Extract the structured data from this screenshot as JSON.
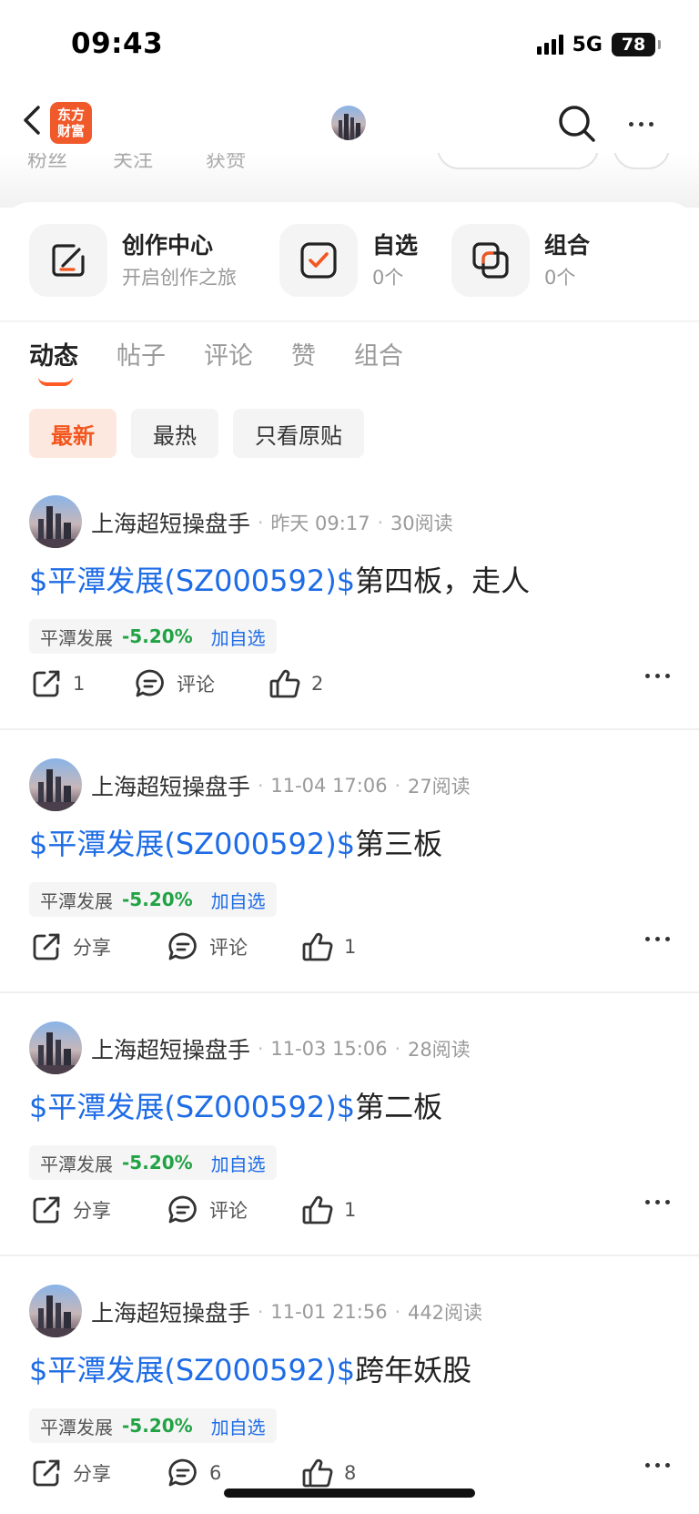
{
  "status_bar": {
    "time": "09:43",
    "network": "5G",
    "battery": "78"
  },
  "header": {
    "app_logo_line1": "东方",
    "app_logo_line2": "财富"
  },
  "faded_row": {
    "labels": [
      "粉丝",
      "关注",
      "获赞"
    ]
  },
  "quick_actions": [
    {
      "title": "创作中心",
      "subtitle": "开启创作之旅",
      "icon": "edit-icon"
    },
    {
      "title": "自选",
      "subtitle": "0个",
      "icon": "checkbox-icon"
    },
    {
      "title": "组合",
      "subtitle": "0个",
      "icon": "portfolio-icon"
    }
  ],
  "tabs": [
    {
      "label": "动态",
      "active": true
    },
    {
      "label": "帖子",
      "active": false
    },
    {
      "label": "评论",
      "active": false
    },
    {
      "label": "赞",
      "active": false
    },
    {
      "label": "组合",
      "active": false
    }
  ],
  "filters": [
    {
      "label": "最新",
      "active": true
    },
    {
      "label": "最热",
      "active": false
    },
    {
      "label": "只看原贴",
      "active": false
    }
  ],
  "colors": {
    "accent": "#f3561f",
    "link": "#1e6ce6",
    "price_down": "#21a345"
  },
  "posts": [
    {
      "author": "上海超短操盘手",
      "time": "昨天 09:17",
      "reads": "30阅读",
      "stock_link": "$平潭发展(SZ000592)$",
      "title_rest": "第四板，走人",
      "stock_name": "平潭发展",
      "stock_change": "-5.20%",
      "add_watch": "加自选",
      "share": "1",
      "comment": "评论",
      "like": "2"
    },
    {
      "author": "上海超短操盘手",
      "time": "11-04 17:06",
      "reads": "27阅读",
      "stock_link": "$平潭发展(SZ000592)$",
      "title_rest": "第三板",
      "stock_name": "平潭发展",
      "stock_change": "-5.20%",
      "add_watch": "加自选",
      "share": "分享",
      "comment": "评论",
      "like": "1"
    },
    {
      "author": "上海超短操盘手",
      "time": "11-03 15:06",
      "reads": "28阅读",
      "stock_link": "$平潭发展(SZ000592)$",
      "title_rest": "第二板",
      "stock_name": "平潭发展",
      "stock_change": "-5.20%",
      "add_watch": "加自选",
      "share": "分享",
      "comment": "评论",
      "like": "1"
    },
    {
      "author": "上海超短操盘手",
      "time": "11-01 21:56",
      "reads": "442阅读",
      "stock_link": "$平潭发展(SZ000592)$",
      "title_rest": "跨年妖股",
      "stock_name": "平潭发展",
      "stock_change": "-5.20%",
      "add_watch": "加自选",
      "share": "分享",
      "comment": "6",
      "like": "8"
    }
  ]
}
